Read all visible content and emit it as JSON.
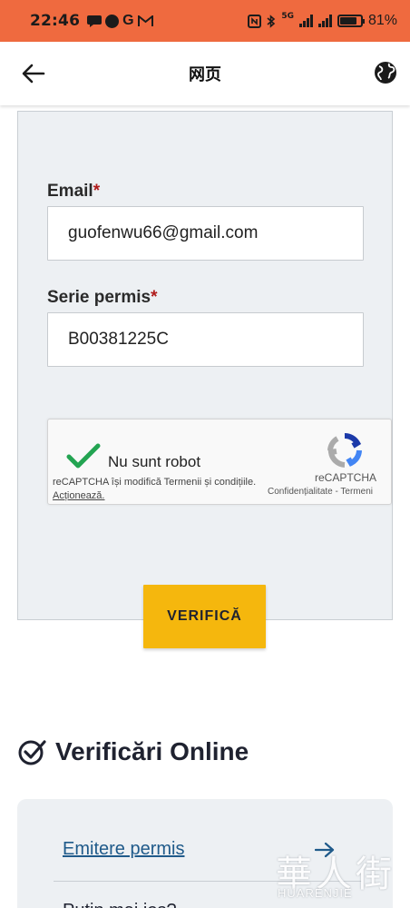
{
  "status_bar": {
    "time": "22:46",
    "left_icons": [
      "chat-bubble-icon",
      "badge-icon",
      "g-icon",
      "m-icon"
    ],
    "network_label": "5G",
    "battery_text": "81%",
    "battery_level": 0.81,
    "color": "#ef6a3f"
  },
  "app_bar": {
    "title": "网页",
    "back_icon": "arrow-left-icon",
    "globe_icon": "globe-icon"
  },
  "form": {
    "email_label": "Email",
    "email_value": "guofenwu66@gmail.com",
    "permit_label": "Serie permis",
    "permit_value": "B00381225C",
    "required_mark": "*"
  },
  "recaptcha": {
    "label": "Nu sunt robot",
    "brand": "reCAPTCHA",
    "links": "Confidențialitate - Termeni",
    "notice": "reCAPTCHA își modifică Termenii și condițiile.",
    "action": "Acționează.",
    "checked": true
  },
  "verify_button": {
    "label": "VERIFICĂ",
    "color": "#f5b70d"
  },
  "online_section": {
    "title": "Verificări Online",
    "link_1": "Emitere permis",
    "link_2": "Puțin mai jos?"
  },
  "watermark": {
    "glyphs": "華人街",
    "text": "HUARENJIE"
  }
}
